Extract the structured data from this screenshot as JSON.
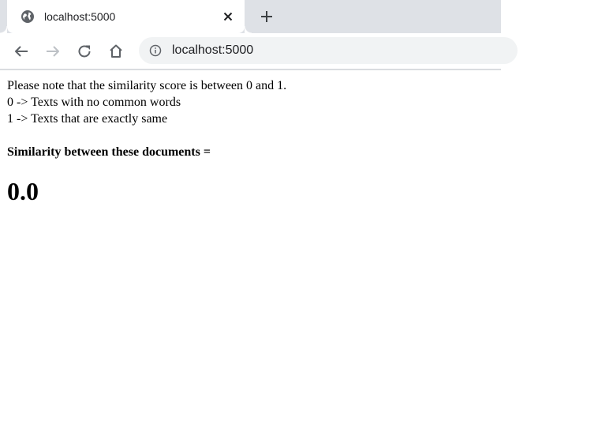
{
  "browser": {
    "tab": {
      "title": "localhost:5000",
      "icon": "globe-icon"
    },
    "address_bar": {
      "url": "localhost:5000",
      "icon": "info-icon"
    },
    "colors": {
      "tabstrip": "#dee1e6",
      "omnibox": "#f1f3f4"
    }
  },
  "page": {
    "note_line1": "Please note that the similarity score is between 0 and 1.",
    "note_line2": "0 -> Texts with no common words",
    "note_line3": "1 -> Texts that are exactly same",
    "result_label": "Similarity between these documents =",
    "result_value": "0.0"
  }
}
